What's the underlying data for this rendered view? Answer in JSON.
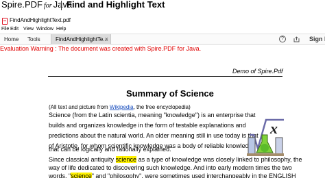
{
  "banner": {
    "brand_main": "Spire.PDF",
    "brand_for": "for",
    "brand_lang": "Java",
    "title": "Find and Highlight Text"
  },
  "window": {
    "title": "FindAndHighlightText.pdf"
  },
  "menu": [
    "File",
    "Edit",
    "View",
    "Window",
    "Help"
  ],
  "toolbar": {
    "home": "Home",
    "tools": "Tools",
    "tab_label": "FindAndHighlightTe...",
    "tab_close": "×",
    "help": "?",
    "sign_in": "Sign I"
  },
  "document": {
    "evaluation_warning": "Evaluation Warning : The document was created with Spire.PDF for Java.",
    "header_right": "Demo of Spire.Pdf",
    "heading": "Summary of Science",
    "note_prefix": "(All text and picture from ",
    "note_link": "Wikipedia",
    "note_suffix": ", the free encyclopedia)",
    "para_lines": [
      "Science (from the Latin scientia, meaning \"knowledge\") is an enterprise that",
      "builds and organizes knowledge in the form of testable explanations and",
      "predictions about the natural world. An older meaning still in use today is that",
      "of Aristotle, for whom scientific knowledge was a body of reliable knowledge",
      "that can be logically and rationally explained."
    ],
    "line6_before": "Since classical antiquity ",
    "line6_highlight": "science",
    "line6_after": " as a type of knowledge was closely linked to philosophy, the",
    "line7": "way of life dedicated to discovering such knowledge. And into early modern times the two",
    "line8_before": "words, \"",
    "line8_highlight": "science",
    "line8_after": "\" and \"philosophy\", were sometimes used interchangeably in the ENGLISH"
  },
  "colors": {
    "warning": "#e00000",
    "highlight": "#fff200",
    "link": "#1a4fbf"
  }
}
